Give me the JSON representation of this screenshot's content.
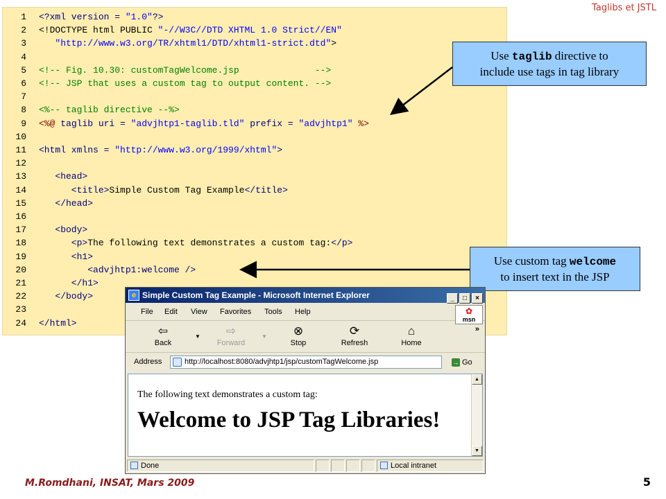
{
  "slide": {
    "header": "Taglibs et JSTL",
    "footer": "M.Romdhani, INSAT, Mars 2009",
    "page_number": "5"
  },
  "code": {
    "lines": [
      {
        "n": "1",
        "segs": [
          {
            "c": "kw",
            "t": "<?xml version = "
          },
          {
            "c": "st",
            "t": "\"1.0\""
          },
          {
            "c": "kw",
            "t": "?>"
          }
        ]
      },
      {
        "n": "2",
        "segs": [
          {
            "c": "tx",
            "t": "<!DOCTYPE html PUBLIC "
          },
          {
            "c": "st",
            "t": "\"-//W3C//DTD XHTML 1.0 Strict//EN\""
          }
        ]
      },
      {
        "n": "3",
        "segs": [
          {
            "c": "tx",
            "t": "   "
          },
          {
            "c": "st",
            "t": "\"http://www.w3.org/TR/xhtml1/DTD/xhtml1-strict.dtd\""
          },
          {
            "c": "tx",
            "t": ">"
          }
        ]
      },
      {
        "n": "4",
        "segs": []
      },
      {
        "n": "5",
        "segs": [
          {
            "c": "cm",
            "t": "<!-- Fig. 10.30: customTagWelcome.jsp              -->"
          }
        ]
      },
      {
        "n": "6",
        "segs": [
          {
            "c": "cm",
            "t": "<!-- JSP that uses a custom tag to output content. -->"
          }
        ]
      },
      {
        "n": "7",
        "segs": []
      },
      {
        "n": "8",
        "segs": [
          {
            "c": "cm",
            "t": "<%-- taglib directive --%>"
          }
        ]
      },
      {
        "n": "9",
        "segs": [
          {
            "c": "ds",
            "t": "<%@ "
          },
          {
            "c": "kw",
            "t": "taglib uri = "
          },
          {
            "c": "st",
            "t": "\"advjhtp1-taglib.tld\""
          },
          {
            "c": "kw",
            "t": " prefix = "
          },
          {
            "c": "st",
            "t": "\"advjhtp1\""
          },
          {
            "c": "ds",
            "t": " %>"
          }
        ]
      },
      {
        "n": "10",
        "segs": []
      },
      {
        "n": "11",
        "segs": [
          {
            "c": "kw",
            "t": "<html xmlns = "
          },
          {
            "c": "st",
            "t": "\"http://www.w3.org/1999/xhtml\""
          },
          {
            "c": "kw",
            "t": ">"
          }
        ]
      },
      {
        "n": "12",
        "segs": []
      },
      {
        "n": "13",
        "segs": [
          {
            "c": "kw",
            "t": "   <head>"
          }
        ]
      },
      {
        "n": "14",
        "segs": [
          {
            "c": "kw",
            "t": "      <title>"
          },
          {
            "c": "tx",
            "t": "Simple Custom Tag Example"
          },
          {
            "c": "kw",
            "t": "</title>"
          }
        ]
      },
      {
        "n": "15",
        "segs": [
          {
            "c": "kw",
            "t": "   </head>"
          }
        ]
      },
      {
        "n": "16",
        "segs": []
      },
      {
        "n": "17",
        "segs": [
          {
            "c": "kw",
            "t": "   <body>"
          }
        ]
      },
      {
        "n": "18",
        "segs": [
          {
            "c": "kw",
            "t": "      <p>"
          },
          {
            "c": "tx",
            "t": "The following text demonstrates a custom tag:"
          },
          {
            "c": "kw",
            "t": "</p>"
          }
        ]
      },
      {
        "n": "19",
        "segs": [
          {
            "c": "kw",
            "t": "      <h1>"
          }
        ]
      },
      {
        "n": "20",
        "segs": [
          {
            "c": "kw",
            "t": "         <advjhtp1:welcome />"
          }
        ]
      },
      {
        "n": "21",
        "segs": [
          {
            "c": "kw",
            "t": "      </h1>"
          }
        ]
      },
      {
        "n": "22",
        "segs": [
          {
            "c": "kw",
            "t": "   </body>"
          }
        ]
      },
      {
        "n": "23",
        "segs": []
      },
      {
        "n": "24",
        "segs": [
          {
            "c": "kw",
            "t": "</html>"
          }
        ]
      }
    ]
  },
  "callouts": {
    "taglib": {
      "pre": "Use ",
      "mono": "taglib",
      "post": " directive to",
      "line2": "include use tags in tag library"
    },
    "welcome": {
      "pre": "Use custom tag ",
      "mono": "welcome",
      "line2": "to insert text in the JSP"
    }
  },
  "browser": {
    "title": "Simple Custom Tag Example - Microsoft Internet Explorer",
    "window_buttons": [
      "_",
      "□",
      "×"
    ],
    "menu": [
      "File",
      "Edit",
      "View",
      "Favorites",
      "Tools",
      "Help"
    ],
    "msn": "msn",
    "toolbar": {
      "back": "Back",
      "forward": "Forward",
      "stop": "Stop",
      "refresh": "Refresh",
      "home": "Home",
      "more": "»"
    },
    "address_label": "Address",
    "address_url": "http://localhost:8080/advjhtp1/jsp/customTagWelcome.jsp",
    "go_label": "Go",
    "page_text": "The following text demonstrates a custom tag:",
    "page_heading": "Welcome to JSP Tag Libraries!",
    "status_done": "Done",
    "status_zone": "Local intranet"
  },
  "colors": {
    "code_bg": "#ffeeb0",
    "callout_bg": "#99ccff",
    "footer": "#8b1a1a",
    "header": "#c0392b"
  }
}
